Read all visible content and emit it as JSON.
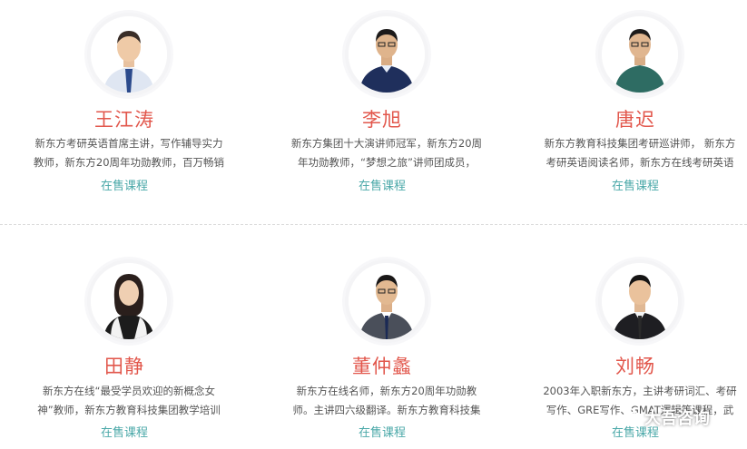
{
  "teachers": [
    {
      "name": "王江涛",
      "desc_line1": "新东方考研英语首席主讲，写作辅导实力",
      "desc_line2": "教师，新东方20周年功勋教师，百万畅销",
      "course_link": "在售课程",
      "shirt": "#dfe6f2",
      "tie": "#2b4a8c"
    },
    {
      "name": "李旭",
      "desc_line1": "新东方集团十大演讲师冠军，新东方20周",
      "desc_line2": "年功勋教师，“梦想之旅”讲师团成员，",
      "course_link": "在售课程",
      "shirt": "#1f2f5c",
      "tie": ""
    },
    {
      "name": "唐迟",
      "desc_line1": "新东方教育科技集团考研巡讲师， 新东方",
      "desc_line2": "考研英语阅读名师，新东方在线考研英语",
      "course_link": "在售课程",
      "shirt": "#2e6c63",
      "tie": ""
    },
    {
      "name": "田静",
      "desc_line1": "新东方在线“最受学员欢迎的新概念女",
      "desc_line2": "神”教师，新东方教育科技集团教学培训",
      "course_link": "在售课程",
      "shirt": "#1c1c1c",
      "tie": ""
    },
    {
      "name": "董仲蠡",
      "desc_line1": "新东方在线名师，新东方20周年功勋教",
      "desc_line2": "师。主讲四六级翻译。新东方教育科技集",
      "course_link": "在售课程",
      "shirt": "#4a4f5a",
      "tie": "#1b2a55"
    },
    {
      "name": "刘畅",
      "desc_line1": "2003年入职新东方，主讲考研词汇、考研",
      "desc_line2": "写作、GRE写作、GMAT逻辑等课程，武",
      "course_link": "在售课程",
      "shirt": "#1e1e22",
      "tie": "#2a2a2a"
    }
  ],
  "watermark": {
    "text": "大吾咨询",
    "icon": "wechat-icon"
  },
  "colors": {
    "name": "#e2574c",
    "link": "#4aa8a8",
    "text": "#555555"
  }
}
